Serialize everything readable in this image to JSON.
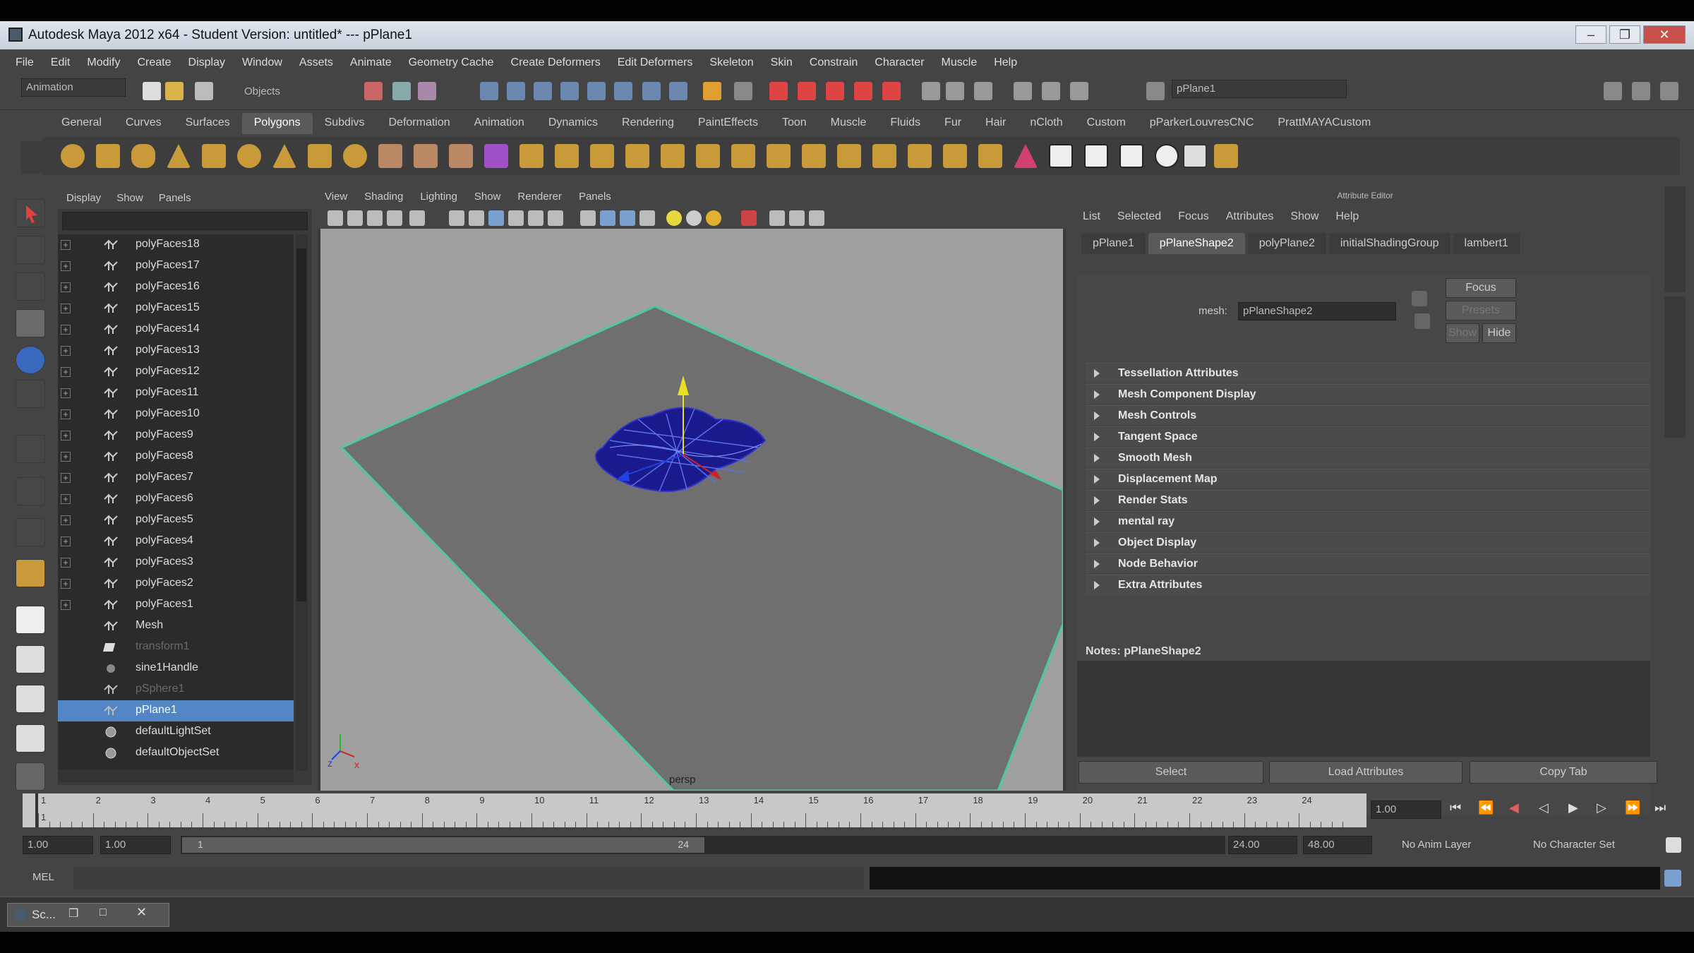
{
  "window": {
    "title": "Autodesk Maya 2012 x64 - Student Version: untitled*   ---   pPlane1",
    "controls": [
      "–",
      "❐",
      "✕"
    ]
  },
  "menubar": [
    "File",
    "Edit",
    "Modify",
    "Create",
    "Display",
    "Window",
    "Assets",
    "Animate",
    "Geometry Cache",
    "Create Deformers",
    "Edit Deformers",
    "Skeleton",
    "Skin",
    "Constrain",
    "Character",
    "Muscle",
    "Help"
  ],
  "statusline": {
    "menuset": "Animation",
    "selmode": "Objects",
    "name_field": "pPlane1"
  },
  "shelf_tabs": [
    "General",
    "Curves",
    "Surfaces",
    "Polygons",
    "Subdivs",
    "Deformation",
    "Animation",
    "Dynamics",
    "Rendering",
    "PaintEffects",
    "Toon",
    "Muscle",
    "Fluids",
    "Fur",
    "Hair",
    "nCloth",
    "Custom",
    "pParkerLouvresCNC",
    "PrattMAYACustom"
  ],
  "shelf_active": "Polygons",
  "outliner": {
    "menu": [
      "Display",
      "Show",
      "Panels"
    ],
    "items": [
      {
        "label": "polyFaces18"
      },
      {
        "label": "polyFaces17"
      },
      {
        "label": "polyFaces16"
      },
      {
        "label": "polyFaces15"
      },
      {
        "label": "polyFaces14"
      },
      {
        "label": "polyFaces13"
      },
      {
        "label": "polyFaces12"
      },
      {
        "label": "polyFaces11"
      },
      {
        "label": "polyFaces10"
      },
      {
        "label": "polyFaces9"
      },
      {
        "label": "polyFaces8"
      },
      {
        "label": "polyFaces7"
      },
      {
        "label": "polyFaces6"
      },
      {
        "label": "polyFaces5"
      },
      {
        "label": "polyFaces4"
      },
      {
        "label": "polyFaces3"
      },
      {
        "label": "polyFaces2"
      },
      {
        "label": "polyFaces1"
      },
      {
        "label": "Mesh"
      },
      {
        "label": "transform1"
      },
      {
        "label": "sine1Handle"
      },
      {
        "label": "pSphere1"
      },
      {
        "label": "pPlane1"
      },
      {
        "label": "defaultLightSet"
      },
      {
        "label": "defaultObjectSet"
      }
    ]
  },
  "viewport": {
    "menu": [
      "View",
      "Shading",
      "Lighting",
      "Show",
      "Renderer",
      "Panels"
    ],
    "camera_label": "persp"
  },
  "attribute_editor": {
    "header": "Attribute Editor",
    "menu": [
      "List",
      "Selected",
      "Focus",
      "Attributes",
      "Show",
      "Help"
    ],
    "tabs": [
      "pPlane1",
      "pPlaneShape2",
      "polyPlane2",
      "initialShadingGroup",
      "lambert1"
    ],
    "active_tab": "pPlaneShape2",
    "mesh_label": "mesh:",
    "mesh_value": "pPlaneShape2",
    "focus_btn": "Focus",
    "presets_btn": "Presets",
    "show_btn": "Show",
    "hide_btn": "Hide",
    "sections": [
      "Tessellation Attributes",
      "Mesh Component Display",
      "Mesh Controls",
      "Tangent Space",
      "Smooth Mesh",
      "Displacement Map",
      "Render Stats",
      "mental ray",
      "Object Display",
      "Node Behavior",
      "Extra Attributes"
    ],
    "notes_label": "Notes:  pPlaneShape2",
    "bottom_buttons": [
      "Select",
      "Load Attributes",
      "Copy Tab"
    ]
  },
  "timeline": {
    "ticks": [
      1,
      2,
      3,
      4,
      5,
      6,
      7,
      8,
      9,
      10,
      11,
      12,
      13,
      14,
      15,
      16,
      17,
      18,
      19,
      20,
      21,
      22,
      23,
      24
    ],
    "current_frame": "1.00",
    "current_marker": "1"
  },
  "range": {
    "start": "1.00",
    "start2": "1.00",
    "slider_start": "1",
    "slider_end": "24",
    "end": "24.00",
    "end2": "48.00",
    "anim_layer": "No Anim Layer",
    "char_set": "No Character Set"
  },
  "mel": {
    "label": "MEL"
  },
  "taskbar": {
    "label": "Sc..."
  },
  "colors": {
    "selection": "#5285c4",
    "mesh": "#1a1a8c",
    "plane": "#6e6e6e"
  }
}
